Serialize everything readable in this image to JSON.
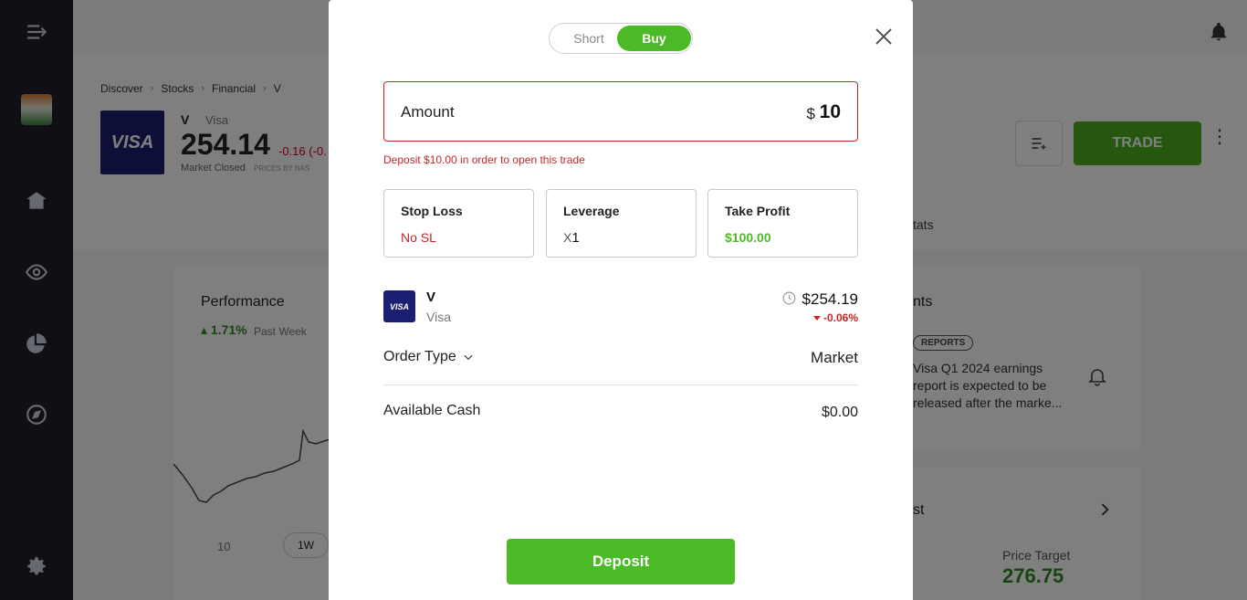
{
  "background": {
    "breadcrumb": [
      "Discover",
      "Stocks",
      "Financial",
      "V"
    ],
    "ticker": {
      "symbol": "V",
      "name": "Visa",
      "logo_text": "VISA",
      "price": "254.14",
      "change": "-0.16 (-0.",
      "status": "Market Closed",
      "prices_by": "PRICES BY NAS"
    },
    "trade_button": "TRADE",
    "tab_stats": "tats",
    "performance": {
      "title": "Performance",
      "change": "1.71%",
      "period": "Past Week",
      "tick": "10",
      "range_button": "1W"
    },
    "events": {
      "title": "nts",
      "badge": "REPORTS",
      "line1": "Visa Q1 2024 earnings",
      "line2": "report is expected to be",
      "line3": "released after the marke..."
    },
    "analyst": {
      "title": "st",
      "price_target_label": "Price Target",
      "price_target_value": "276.75"
    }
  },
  "modal": {
    "toggle": {
      "short": "Short",
      "buy": "Buy",
      "selected": "Buy"
    },
    "amount": {
      "label": "Amount",
      "currency": "$",
      "value": "10"
    },
    "error": "Deposit $10.00 in order to open this trade",
    "stop_loss": {
      "label": "Stop Loss",
      "value": "No SL"
    },
    "leverage": {
      "label": "Leverage",
      "prefix": "X",
      "value": "1"
    },
    "take_profit": {
      "label": "Take Profit",
      "value": "$100.00"
    },
    "asset": {
      "logo_text": "VISA",
      "symbol": "V",
      "name": "Visa",
      "price": "$254.19",
      "change": "-0.06%"
    },
    "order_type": {
      "label": "Order Type",
      "value": "Market"
    },
    "available_cash": {
      "label": "Available Cash",
      "value": "$0.00"
    },
    "deposit_button": "Deposit"
  },
  "colors": {
    "accent_green": "#4cba26",
    "error_red": "#c62828",
    "visa_blue": "#1a1f71",
    "sidebar": "#1f1f2b"
  }
}
